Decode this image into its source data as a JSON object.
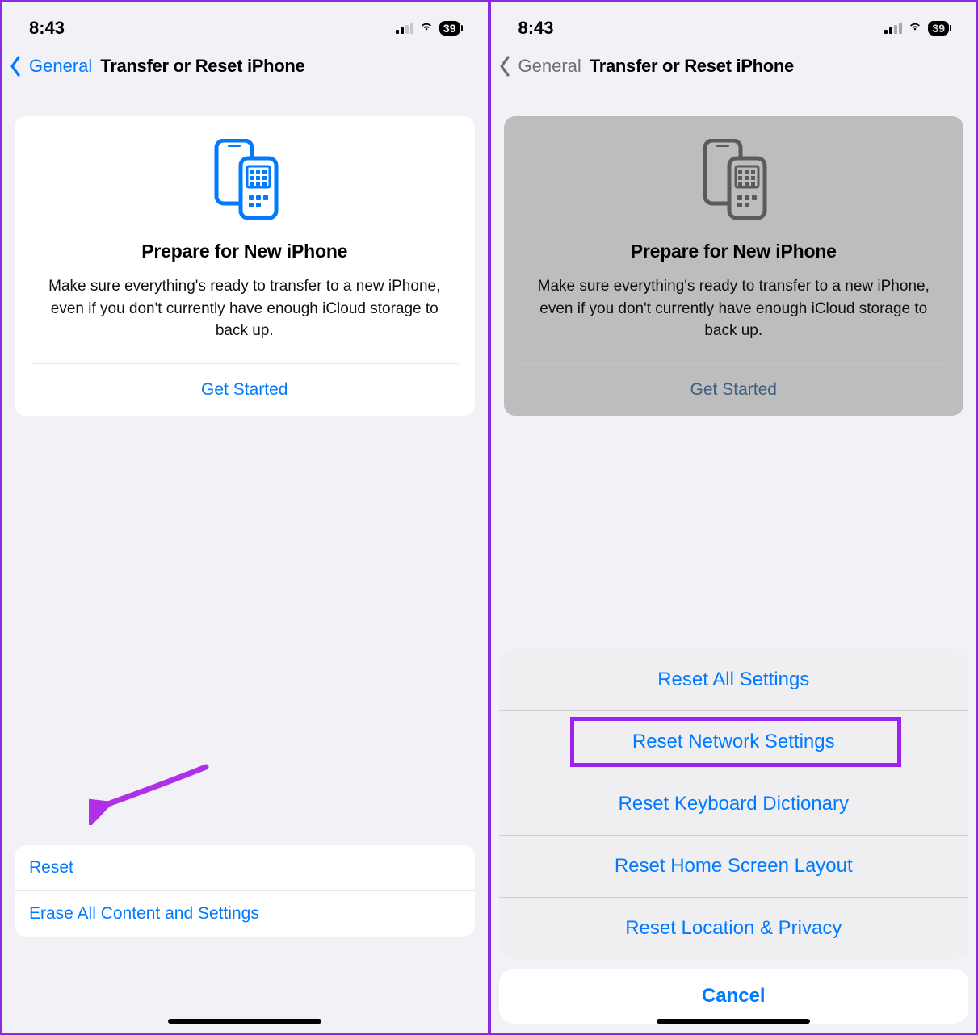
{
  "status": {
    "time": "8:43",
    "battery": "39"
  },
  "nav": {
    "back": "General",
    "title": "Transfer or Reset iPhone"
  },
  "card": {
    "title": "Prepare for New iPhone",
    "desc": "Make sure everything's ready to transfer to a new iPhone, even if you don't currently have enough iCloud storage to back up.",
    "get_started": "Get Started"
  },
  "bottom": {
    "reset": "Reset",
    "erase": "Erase All Content and Settings"
  },
  "sheet": {
    "items": [
      "Reset All Settings",
      "Reset Network Settings",
      "Reset Keyboard Dictionary",
      "Reset Home Screen Layout",
      "Reset Location & Privacy"
    ],
    "cancel": "Cancel"
  }
}
